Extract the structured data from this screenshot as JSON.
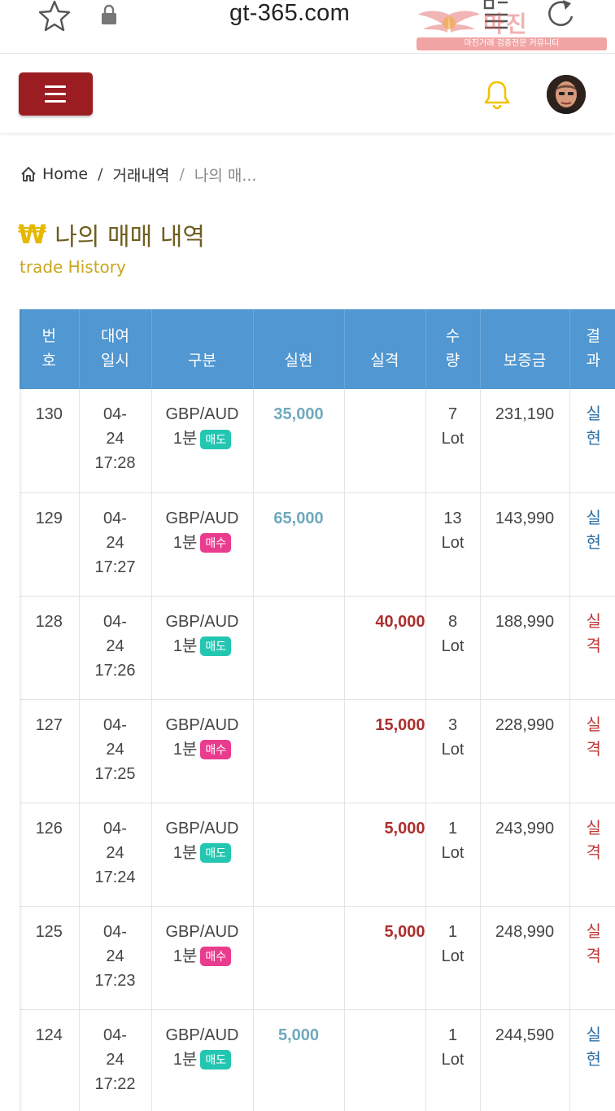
{
  "browser": {
    "url": "gt-365.com",
    "watermark": "마진거래 검증전문 커뮤니티",
    "watermark_logo": "마진"
  },
  "header": {
    "menu_label": "menu",
    "colors": {
      "menu_button": "#9b1d22",
      "bell": "#f2c200"
    }
  },
  "breadcrumb": {
    "home": "Home",
    "sep1": "/",
    "level1": "거래내역",
    "sep2": "/",
    "current": "나의 매..."
  },
  "page": {
    "icon": "₩",
    "title": "나의 매매 내역",
    "subtitle": "trade History"
  },
  "table": {
    "headers": {
      "no_1": "번",
      "no_2": "호",
      "date_1": "대여",
      "date_2": "일시",
      "type": "구분",
      "gain": "실현",
      "loss": "실격",
      "qty_1": "수",
      "qty_2": "량",
      "deposit": "보증금",
      "result_1": "결",
      "result_2": "과"
    },
    "rows": [
      {
        "no": "130",
        "date_1": "04-",
        "date_2": "24",
        "time": "17:28",
        "pair": "GBP/AUD",
        "period": "1분",
        "side": "매도",
        "gain": "35,000",
        "loss": "",
        "qty_1": "7",
        "qty_2": "Lot",
        "deposit": "231,190",
        "result_1": "실",
        "result_2": "현"
      },
      {
        "no": "129",
        "date_1": "04-",
        "date_2": "24",
        "time": "17:27",
        "pair": "GBP/AUD",
        "period": "1분",
        "side": "매수",
        "gain": "65,000",
        "loss": "",
        "qty_1": "13",
        "qty_2": "Lot",
        "deposit": "143,990",
        "result_1": "실",
        "result_2": "현"
      },
      {
        "no": "128",
        "date_1": "04-",
        "date_2": "24",
        "time": "17:26",
        "pair": "GBP/AUD",
        "period": "1분",
        "side": "매도",
        "gain": "",
        "loss": "40,000",
        "qty_1": "8",
        "qty_2": "Lot",
        "deposit": "188,990",
        "result_1": "실",
        "result_2": "격"
      },
      {
        "no": "127",
        "date_1": "04-",
        "date_2": "24",
        "time": "17:25",
        "pair": "GBP/AUD",
        "period": "1분",
        "side": "매수",
        "gain": "",
        "loss": "15,000",
        "qty_1": "3",
        "qty_2": "Lot",
        "deposit": "228,990",
        "result_1": "실",
        "result_2": "격"
      },
      {
        "no": "126",
        "date_1": "04-",
        "date_2": "24",
        "time": "17:24",
        "pair": "GBP/AUD",
        "period": "1분",
        "side": "매도",
        "gain": "",
        "loss": "5,000",
        "qty_1": "1",
        "qty_2": "Lot",
        "deposit": "243,990",
        "result_1": "실",
        "result_2": "격"
      },
      {
        "no": "125",
        "date_1": "04-",
        "date_2": "24",
        "time": "17:23",
        "pair": "GBP/AUD",
        "period": "1분",
        "side": "매수",
        "gain": "",
        "loss": "5,000",
        "qty_1": "1",
        "qty_2": "Lot",
        "deposit": "248,990",
        "result_1": "실",
        "result_2": "격"
      },
      {
        "no": "124",
        "date_1": "04-",
        "date_2": "24",
        "time": "17:22",
        "pair": "GBP/AUD",
        "period": "1분",
        "side": "매도",
        "gain": "5,000",
        "loss": "",
        "qty_1": "1",
        "qty_2": "Lot",
        "deposit": "244,590",
        "result_1": "실",
        "result_2": "현"
      }
    ],
    "colors": {
      "header_bg": "#5197d1",
      "sell_badge": "#23c6b0",
      "buy_badge": "#ea3c8f",
      "gain": "#6fa9bd",
      "loss": "#ad2e2e"
    }
  }
}
